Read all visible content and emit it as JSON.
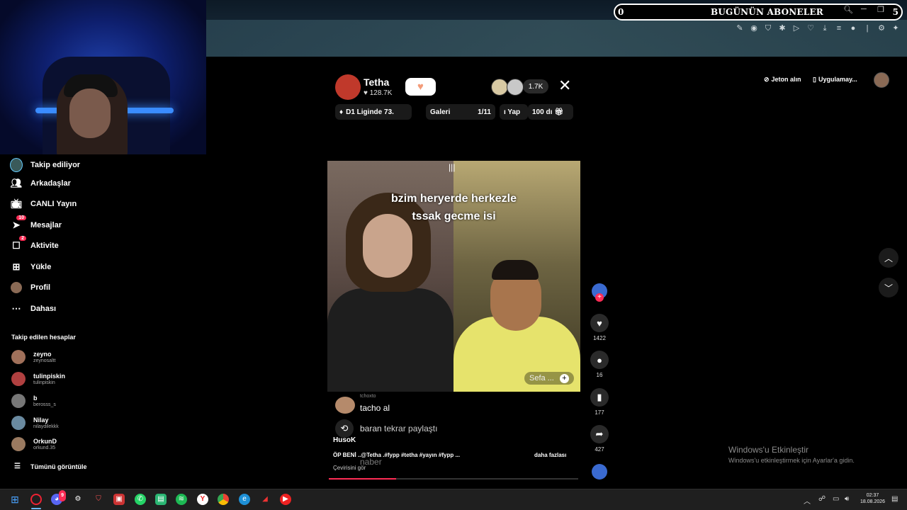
{
  "overlay": {
    "count_left": "0",
    "title": "BUGÜNÜN ABONELER",
    "count_right": "5"
  },
  "live": {
    "host_name": "Tetha",
    "host_likes": "128.7K",
    "viewers": "1.7K",
    "league": "D1 Liginde 73.",
    "gallery_label": "Galeri",
    "gallery_count": "1/11",
    "pill_yap": "ı Yap",
    "pill_100": "100 dı",
    "caption_line1": "bzim heryerde herkezle",
    "caption_line2": "tssak gecme isi",
    "cohost": "Sefa ...",
    "progress": 0.27
  },
  "top_right": {
    "coins": "Jeton alın",
    "app": "Uygulamay..."
  },
  "actions": {
    "likes": "1422",
    "comments": "16",
    "saves": "177",
    "shares": "427"
  },
  "comments": {
    "first_tag": "tchoxto",
    "first_text": "tacho al",
    "share_user": "baran",
    "share_text": "tekrar paylaştı",
    "ghost": "naber",
    "author": "HusoK",
    "description": "ÖP BENİ ..@Tetha .#fypp #tetha #yayın #fypp ...",
    "more": "daha fazlası",
    "translate": "Çevirisini gör"
  },
  "sidebar": {
    "items": [
      {
        "label": "Takip ediliyor"
      },
      {
        "label": "Arkadaşlar"
      },
      {
        "label": "CANLI Yayın"
      },
      {
        "label": "Mesajlar",
        "badge": "10"
      },
      {
        "label": "Aktivite",
        "badge": "2"
      },
      {
        "label": "Yükle"
      },
      {
        "label": "Profil"
      },
      {
        "label": "Dahası"
      }
    ],
    "followed_title": "Takip edilen hesaplar",
    "accounts": [
      {
        "name": "zeyno",
        "handle": "zeynosaltt"
      },
      {
        "name": "tulinpiskin",
        "handle": "tulinpiskin"
      },
      {
        "name": "b",
        "handle": "berosss_s"
      },
      {
        "name": "Nilay",
        "handle": "nilaydilekkk"
      },
      {
        "name": "OrkunD",
        "handle": "orkund.35"
      }
    ],
    "see_all": "Tümünü görüntüle"
  },
  "watermark": {
    "line1": "Windows'u Etkinleştir",
    "line2": "Windows'u etkinleştirmek için Ayarlar'a gidin."
  },
  "taskbar": {
    "time": "02:37",
    "date": "18.08.2026",
    "discord_badge": "9"
  },
  "colors": {
    "accent": "#fe2c55",
    "background": "#000000",
    "follow_heart": "#f39c7a"
  },
  "icons": [
    "webcam-feed",
    "search-icon",
    "minimize-icon",
    "restore-icon",
    "close-icon",
    "heart-icon",
    "comment-icon",
    "bookmark-icon",
    "share-icon",
    "repost-icon",
    "chevron-up-icon",
    "chevron-down-icon",
    "windows-start-icon"
  ]
}
